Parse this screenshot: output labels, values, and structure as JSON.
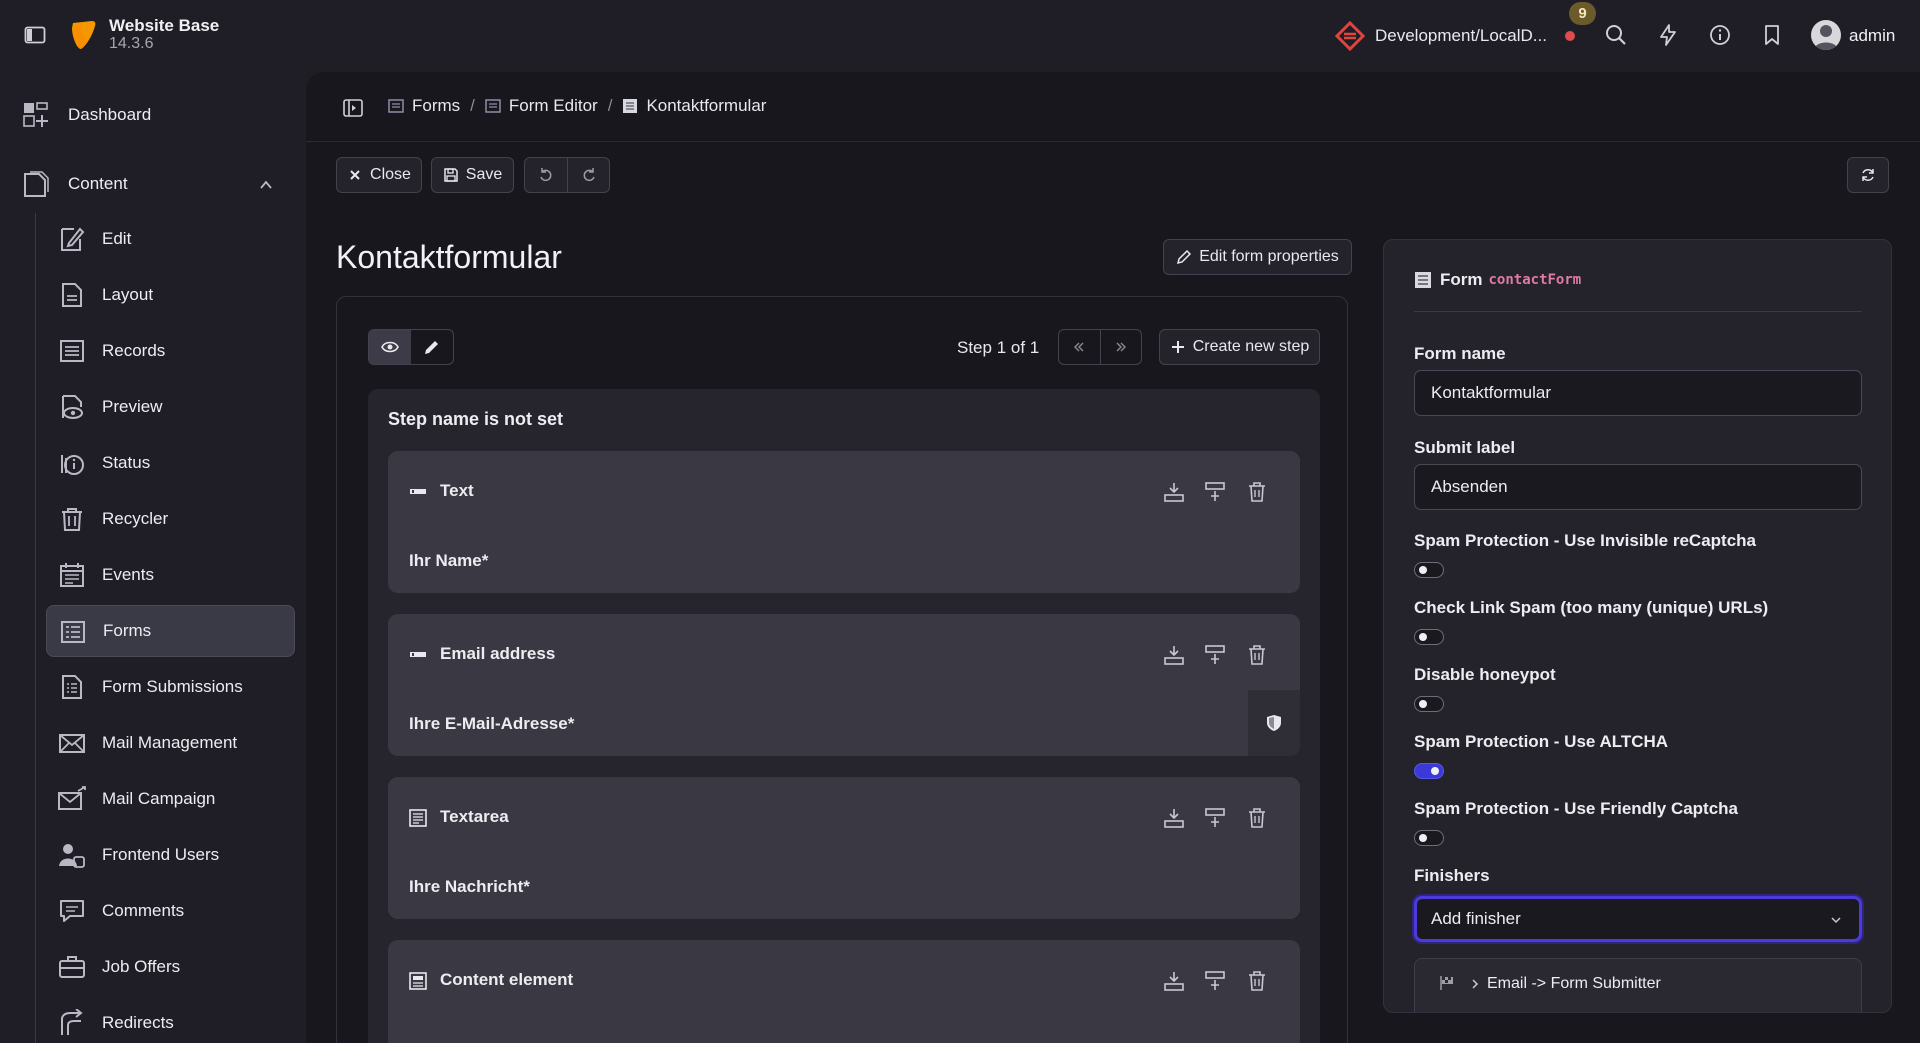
{
  "app": {
    "name": "Website Base",
    "version": "14.3.6"
  },
  "topbar": {
    "site": "Development/LocalD...",
    "notifications": "9",
    "user": "admin"
  },
  "sidebar": {
    "top": [
      {
        "label": "Dashboard"
      },
      {
        "label": "Content"
      }
    ],
    "items": [
      {
        "label": "Edit"
      },
      {
        "label": "Layout"
      },
      {
        "label": "Records"
      },
      {
        "label": "Preview"
      },
      {
        "label": "Status"
      },
      {
        "label": "Recycler"
      },
      {
        "label": "Events"
      },
      {
        "label": "Forms"
      },
      {
        "label": "Form Submissions"
      },
      {
        "label": "Mail Management"
      },
      {
        "label": "Mail Campaign"
      },
      {
        "label": "Frontend Users"
      },
      {
        "label": "Comments"
      },
      {
        "label": "Job Offers"
      },
      {
        "label": "Redirects"
      }
    ],
    "active": "Forms"
  },
  "breadcrumb": [
    "Forms",
    "Form Editor",
    "Kontaktformular"
  ],
  "toolbar": {
    "close": "Close",
    "save": "Save"
  },
  "page": {
    "title": "Kontaktformular",
    "edit_props": "Edit form properties"
  },
  "stage": {
    "step_label": "Step 1 of 1",
    "create_step": "Create new step",
    "step_name": "Step name is not set",
    "elements": [
      {
        "type": "Text",
        "label": "Ihr Name*"
      },
      {
        "type": "Email address",
        "label": "Ihre E-Mail-Adresse*"
      },
      {
        "type": "Textarea",
        "label": "Ihre Nachricht*"
      },
      {
        "type": "Content element",
        "label": ""
      }
    ]
  },
  "inspector": {
    "title": "Form",
    "identifier": "contactForm",
    "form_name_label": "Form name",
    "form_name_value": "Kontaktformular",
    "submit_label": "Submit label",
    "submit_value": "Absenden",
    "toggles": [
      {
        "label": "Spam Protection - Use Invisible reCaptcha",
        "on": false
      },
      {
        "label": "Check Link Spam (too many (unique) URLs)",
        "on": false
      },
      {
        "label": "Disable honeypot",
        "on": false
      },
      {
        "label": "Spam Protection - Use ALTCHA",
        "on": true
      },
      {
        "label": "Spam Protection - Use Friendly Captcha",
        "on": false
      }
    ],
    "finishers_label": "Finishers",
    "add_finisher": "Add finisher",
    "finisher_item": "Email -> Form Submitter"
  },
  "colors": {
    "accent": "#3b3ad8",
    "focus_border": "#4c3ad9",
    "identifier": "#e07aa6",
    "alert": "#e04b4b"
  }
}
